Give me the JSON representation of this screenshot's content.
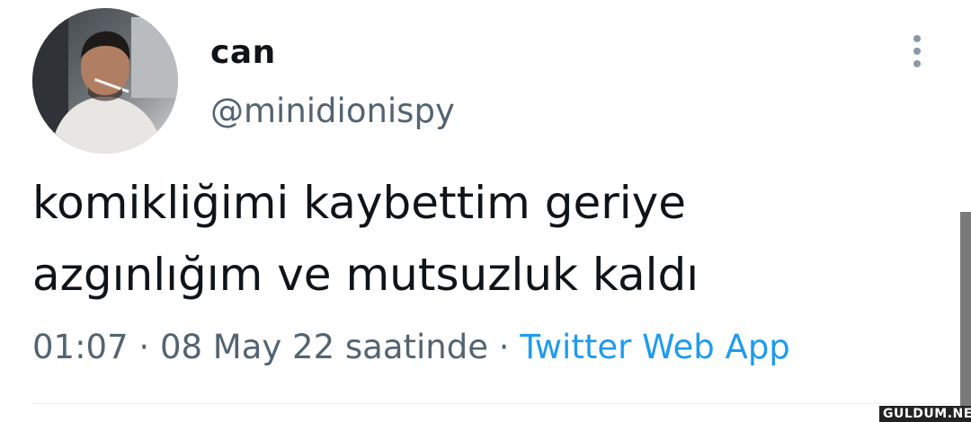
{
  "user": {
    "display_name": "can",
    "handle": "@minidionispy",
    "avatar_icon": "profile-photo"
  },
  "tweet": {
    "lines": [
      "komikliğimi kaybettim geriye",
      "azgınlığım ve mutsuzluk kaldı"
    ],
    "time": "01:07",
    "separator": "·",
    "date": "08 May 22",
    "suffix": "saatinde",
    "source": "Twitter Web App"
  },
  "menu": {
    "icon": "more-options-icon"
  },
  "watermark": {
    "text": "GULDUM.NET"
  },
  "colors": {
    "text_primary": "#0f1419",
    "text_secondary": "#536471",
    "link": "#1d9bf0"
  }
}
